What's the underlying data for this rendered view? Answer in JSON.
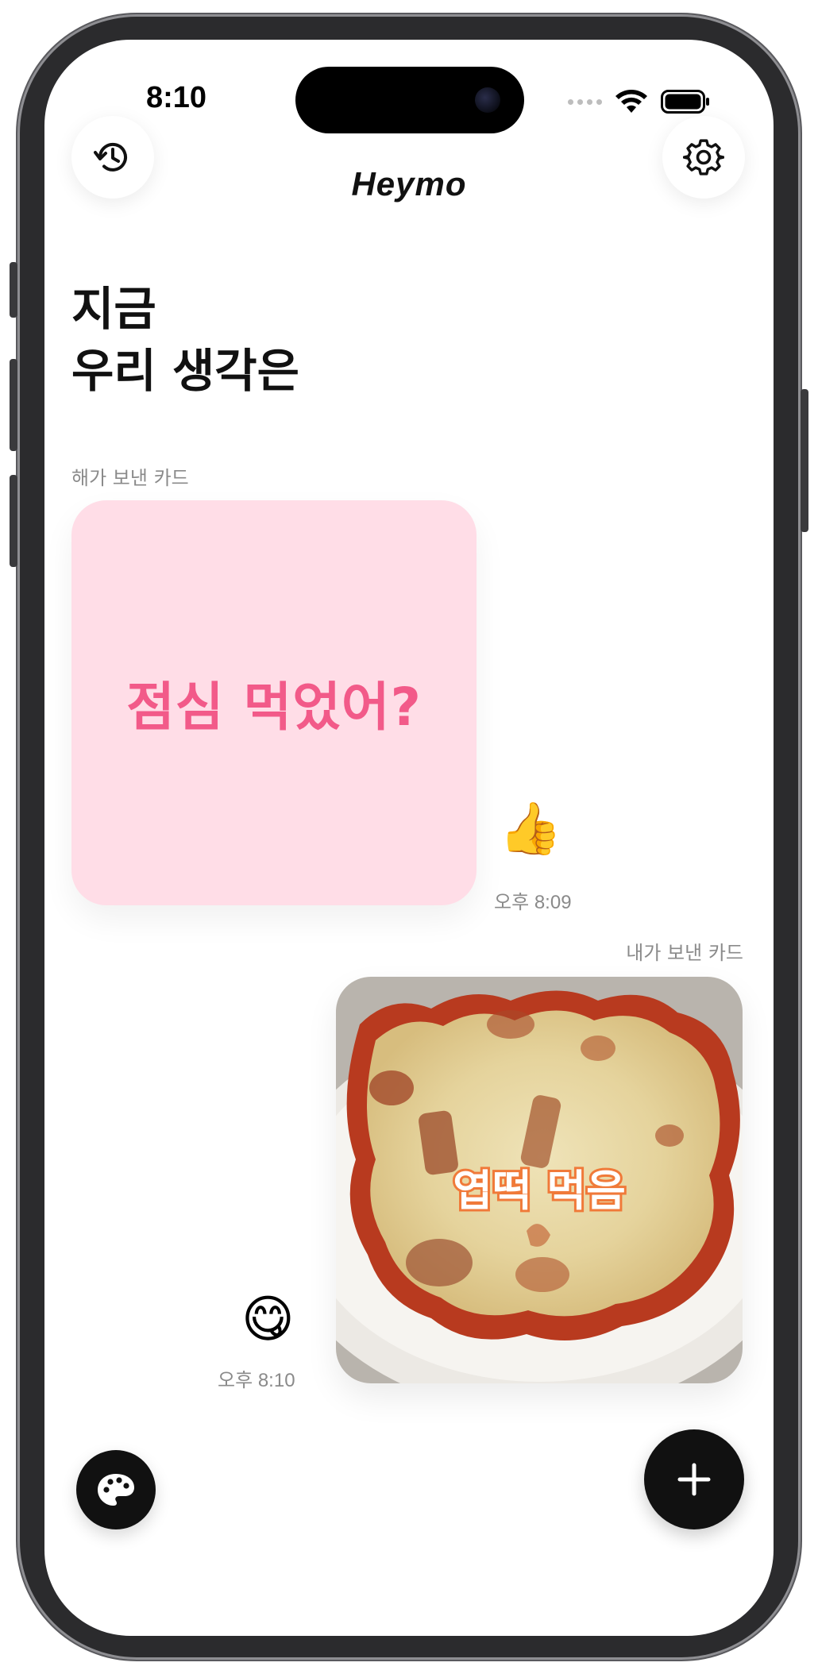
{
  "status_bar": {
    "time": "8:10"
  },
  "header": {
    "app_name": "Heymo",
    "history_icon": "history-clock-icon",
    "settings_icon": "gear-icon"
  },
  "headline": {
    "line1": "지금",
    "line2": "우리 생각은"
  },
  "received_card": {
    "label": "해가 보낸 카드",
    "text": "점심 먹었어?",
    "background": "#ffdde7",
    "text_color": "#f25a89",
    "reaction": "👍",
    "time": "오후 8:09"
  },
  "sent_card": {
    "label": "내가 보낸 카드",
    "text": "엽떡 먹음",
    "reaction": "😋",
    "time": "오후 8:10"
  },
  "bottom": {
    "palette_icon": "palette-icon",
    "add_icon": "plus-icon"
  }
}
